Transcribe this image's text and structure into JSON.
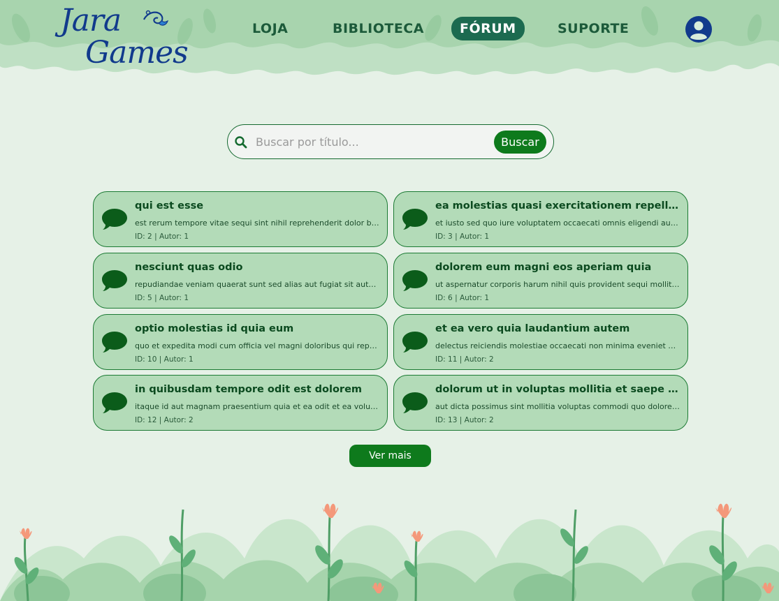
{
  "brand": {
    "logo_line1": "Jara",
    "logo_line2": "Games",
    "logo_color": "#113a8c"
  },
  "nav": {
    "items": [
      {
        "label": "LOJA",
        "active": false
      },
      {
        "label": "BIBLIOTECA",
        "active": false
      },
      {
        "label": "FÓRUM",
        "active": true
      },
      {
        "label": "SUPORTE",
        "active": false
      }
    ],
    "profile_icon": "user-circle-icon"
  },
  "search": {
    "placeholder": "Buscar por título...",
    "value": "",
    "button_label": "Buscar",
    "icon": "search-icon"
  },
  "posts": [
    {
      "title": "qui est esse",
      "body": "est rerum tempore vitae sequi sint nihil reprehenderit dolor beatae ea dolores neque",
      "meta": "ID: 2 | Autor: 1"
    },
    {
      "title": "ea molestias quasi exercitationem repellat qui ipsa sit aut",
      "body": "et iusto sed quo iure voluptatem occaecati omnis eligendi aut ad voluptatem doloribus",
      "meta": "ID: 3 | Autor: 1"
    },
    {
      "title": "nesciunt quas odio",
      "body": "repudiandae veniam quaerat sunt sed alias aut fugiat sit autem sed est voluptatem",
      "meta": "ID: 5 | Autor: 1"
    },
    {
      "title": "dolorem eum magni eos aperiam quia",
      "body": "ut aspernatur corporis harum nihil quis provident sequi mollitia nobis aliquid molestiae",
      "meta": "ID: 6 | Autor: 1"
    },
    {
      "title": "optio molestias id quia eum",
      "body": "quo et expedita modi cum officia vel magni doloribus qui repudiandae vero nisi sit",
      "meta": "ID: 10 | Autor: 1"
    },
    {
      "title": "et ea vero quia laudantium autem",
      "body": "delectus reiciendis molestiae occaecati non minima eveniet qui voluptatibus accusamus",
      "meta": "ID: 11 | Autor: 2"
    },
    {
      "title": "in quibusdam tempore odit est dolorem",
      "body": "itaque id aut magnam praesentium quia et ea odit et ea voluptas et sapiente quia",
      "meta": "ID: 12 | Autor: 2"
    },
    {
      "title": "dolorum ut in voluptas mollitia et saepe quo animi",
      "body": "aut dicta possimus sint mollitia voluptas commodi quo doloremque iste corrupti",
      "meta": "ID: 13 | Autor: 2"
    }
  ],
  "more_button": "Ver mais",
  "colors": {
    "background": "#e6f1e7",
    "card": "#b3dbb8",
    "accent": "#0e7a1c",
    "nav_active": "#1c6a50"
  }
}
